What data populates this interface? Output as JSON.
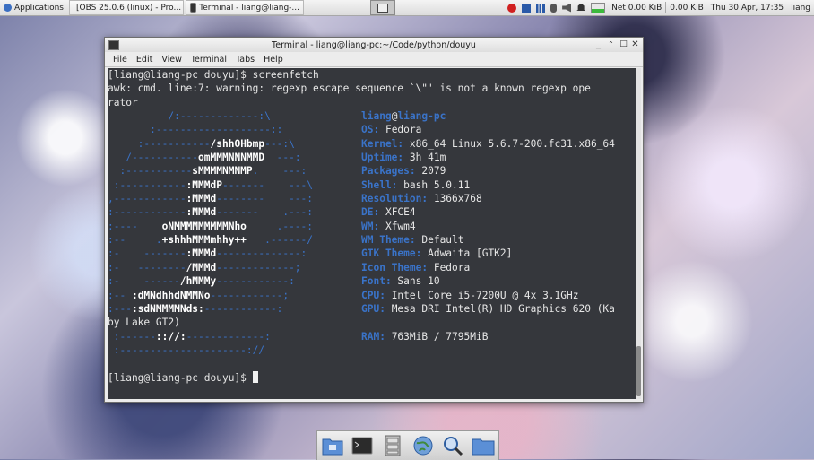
{
  "top_panel": {
    "applications_label": "Applications",
    "tasks": [
      {
        "label": "[OBS 25.0.6 (linux) - Pro..."
      },
      {
        "label": "Terminal - liang@liang-..."
      }
    ],
    "net_label": "Net 0.00 KiB",
    "net2_label": "0.00 KiB",
    "clock": "Thu 30 Apr, 17:35",
    "user": "liang"
  },
  "window": {
    "title": "Terminal - liang@liang-pc:~/Code/python/douyu",
    "menu": [
      "File",
      "Edit",
      "View",
      "Terminal",
      "Tabs",
      "Help"
    ]
  },
  "terminal": {
    "prompt": "[liang@liang-pc douyu]$ ",
    "command": "screenfetch",
    "warning1": "awk: cmd. line:7: warning: regexp escape sequence `\\\"' is not a known regexp ope",
    "warning2": "rator",
    "rows": [
      {
        "a1": "          /:-------------:\\",
        "a2": "",
        "a3": "          ",
        "k": "",
        "v": "",
        "user": "liang",
        "at": "@",
        "host": "liang-pc"
      },
      {
        "a1": "       :-------------------::",
        "a2": "",
        "a3": "        ",
        "k": "OS:",
        "v": " Fedora"
      },
      {
        "a1": "     :-----------",
        "a2": "/shhOHbmp",
        "a3": "---:\\     ",
        "k": "Kernel:",
        "v": " x86_64 Linux 5.6.7-200.fc31.x86_64"
      },
      {
        "a1": "   /-----------",
        "a2": "omMMMNNNMMD",
        "a3": "  ---:    ",
        "k": "Uptime:",
        "v": " 3h 41m"
      },
      {
        "a1": "  :-----------",
        "a2": "sMMMMNMNMP",
        "a3": ".    ---:   ",
        "k": "Packages:",
        "v": " 2079"
      },
      {
        "a1": " :-----------",
        "a2": ":MMMdP",
        "a3": "-------    ---\\  ",
        "k": "Shell:",
        "v": " bash 5.0.11"
      },
      {
        "a1": ",------------",
        "a2": ":MMMd",
        "a3": "--------    ---:  ",
        "k": "Resolution:",
        "v": " 1366x768"
      },
      {
        "a1": ":------------",
        "a2": ":MMMd",
        "a3": "-------    .---:  ",
        "k": "DE:",
        "v": " XFCE4"
      },
      {
        "a1": ":----    ",
        "a2": "oNMMMMMMMMMNho",
        "a3": "     .----:  ",
        "k": "WM:",
        "v": " Xfwm4"
      },
      {
        "a1": ":--     .",
        "a2": "+shhhMMMmhhy++",
        "a3": "   .------/  ",
        "k": "WM Theme:",
        "v": " Default"
      },
      {
        "a1": ":-    -------",
        "a2": ":MMMd",
        "a3": "--------------:  ",
        "k": "GTK Theme:",
        "v": " Adwaita [GTK2]"
      },
      {
        "a1": ":-   --------",
        "a2": "/MMMd",
        "a3": "-------------;   ",
        "k": "Icon Theme:",
        "v": " Fedora"
      },
      {
        "a1": ":-    ------",
        "a2": "/hMMMy",
        "a3": "------------:    ",
        "k": "Font:",
        "v": " Sans 10"
      },
      {
        "a1": ":-- ",
        "a2": ":dMNdhhdNMMNo",
        "a3": "------------;     ",
        "k": "CPU:",
        "v": " Intel Core i5-7200U @ 4x 3.1GHz"
      },
      {
        "a1": ":---",
        "a2": ":sdNMMMMNds:",
        "a3": "------------:      ",
        "k": "GPU:",
        "v": " Mesa DRI Intel(R) HD Graphics 620 (Ka"
      },
      {
        "a1": "",
        "a2": "",
        "a3": "",
        "k": "",
        "v": "",
        "wrap": "by Lake GT2)"
      },
      {
        "a1": " :------",
        "a2": ":://:",
        "a3": "-------------:       ",
        "k": "RAM:",
        "v": " 763MiB / 7795MiB"
      },
      {
        "a1": " :---------------------://",
        "a2": "",
        "a3": "",
        "k": "",
        "v": ""
      }
    ]
  },
  "colors": {
    "ascii_blue": "#3a73c8",
    "terminal_bg": "#0a0c12"
  },
  "dock": {
    "icons": [
      "home-folder-icon",
      "terminal-icon",
      "file-manager-icon",
      "web-browser-icon",
      "search-icon",
      "folder-icon"
    ]
  }
}
